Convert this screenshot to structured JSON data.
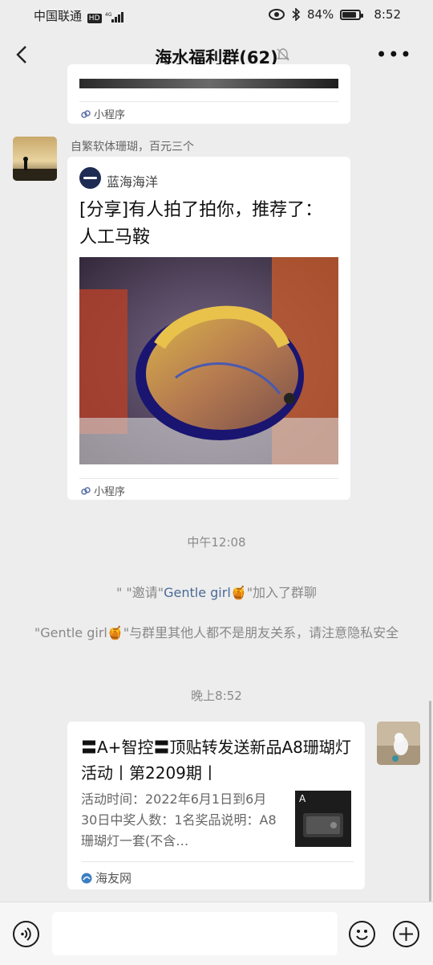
{
  "status_bar": {
    "carrier": "中国联通",
    "network": "HD 4G",
    "battery": "84%",
    "battery_level": 0.84,
    "time": "8:52"
  },
  "header": {
    "title": "海水福利群(62)",
    "back_icon": "back-arrow-icon",
    "mute_icon": "bell-muted-icon",
    "more_icon": "more-dots-icon"
  },
  "messages": {
    "top_card": {
      "mini_program_label": "小程序"
    },
    "share_card": {
      "sender_name": "自繁软体珊瑚，百元三个",
      "source_name": "蓝海海洋",
      "title": "[分享]有人拍了拍你，推荐了：人工马鞍",
      "mini_program_label": "小程序"
    },
    "time_noon": "中午12:08",
    "system_invite": {
      "prefix": "\"  \"邀请\"",
      "name": "Gentle girl",
      "emoji": "🍯",
      "suffix": "\"加入了群聊"
    },
    "system_privacy": {
      "prefix": "\"Gentle girl",
      "emoji": "🍯",
      "suffix": "\"与群里其他人都不是朋友关系，请注意隐私安全"
    },
    "time_evening": "晚上8:52",
    "my_link_card": {
      "title": "〓A+智控〓顶贴转发送新品A8珊瑚灯活动丨第2209期丨",
      "description": "活动时间：2022年6月1日到6月30日中奖人数：1名奖品说明：A8珊瑚灯一套(不含…",
      "source": "海友网"
    }
  },
  "input_bar": {
    "voice_icon": "voice-icon",
    "emoji_icon": "smile-face-icon",
    "add_icon": "plus-circle-icon"
  }
}
